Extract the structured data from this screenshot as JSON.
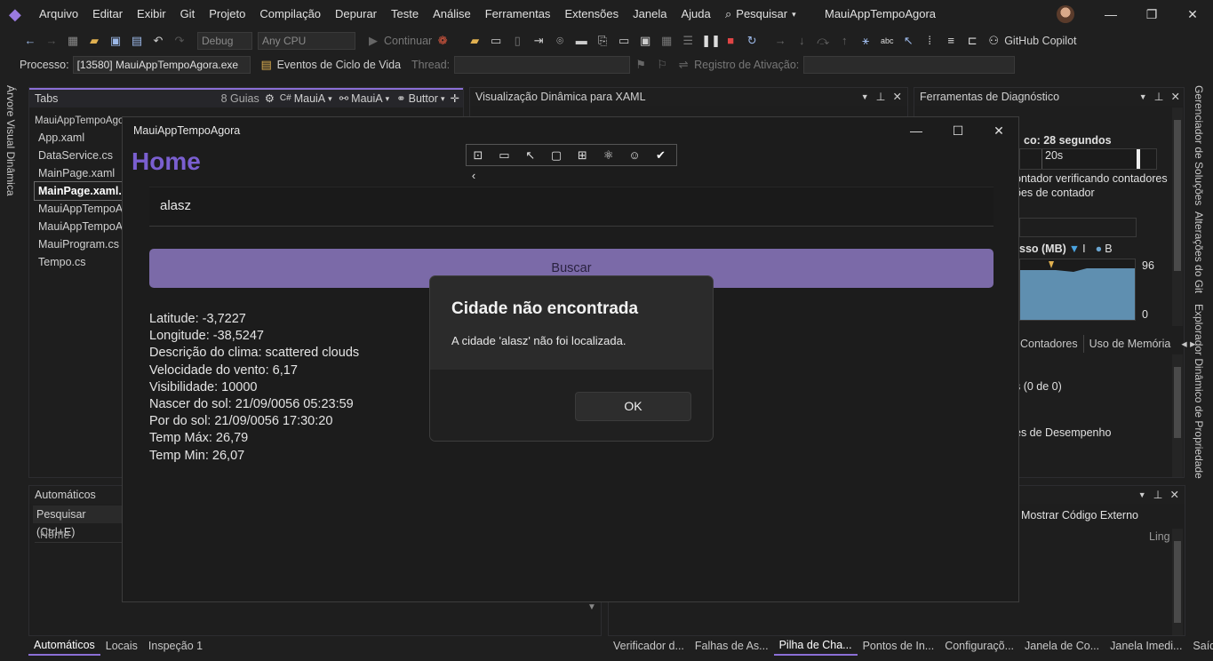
{
  "menubar": {
    "items": [
      "Arquivo",
      "Editar",
      "Exibir",
      "Git",
      "Projeto",
      "Compilação",
      "Depurar",
      "Teste",
      "Análise",
      "Ferramentas",
      "Extensões",
      "Janela",
      "Ajuda"
    ],
    "search_label": "Pesquisar",
    "solution_name": "MauiAppTempoAgora"
  },
  "toolbar1": {
    "config": "Debug",
    "platform": "Any CPU",
    "continue_label": "Continuar",
    "copilot_label": "GitHub Copilot"
  },
  "toolbar2": {
    "process_label": "Processo:",
    "process_value": "[13580] MauiAppTempoAgora.exe",
    "lifecycle_label": "Eventos de Ciclo de Vida",
    "thread_label": "Thread:",
    "stackframe_label": "Registro de Ativação:"
  },
  "left_vtab": "Árvore Visual Dinâmica",
  "right_vtabs": [
    "Gerenciador de Soluções",
    "Alterações do Git",
    "Explorador Dinâmico de Propriedade"
  ],
  "tabs_panel": {
    "title": "Tabs",
    "count": "8 Guias",
    "dd1": "MauiA",
    "dd2": "MauiA",
    "dd3": "Buttor",
    "files": [
      "MauiAppTempoAgora",
      "App.xaml",
      "DataService.cs",
      "MainPage.xaml",
      "MainPage.xaml.cs",
      "MauiAppTempoA",
      "MauiAppTempoA",
      "MauiProgram.cs",
      "Tempo.cs"
    ],
    "selected_index": 4
  },
  "xaml_panel": {
    "title": "Visualização Dinâmica para XAML"
  },
  "diag_panel": {
    "title": "Ferramentas de Diagnóstico",
    "session": "co: 28 segundos",
    "timeline_tick": "20s",
    "counter_msg1": "ontador verificando contadores",
    "counter_msg2": "ões de contador",
    "memory_label": "sso (MB)",
    "legend_a": "I",
    "legend_b": "B",
    "mem_max": "96",
    "mem_min": "0",
    "tabs": [
      "Contadores",
      "Uso de Memória"
    ],
    "events_count": "s (0 de 0)",
    "perf_label": "es de Desempenho"
  },
  "auto_panel": {
    "title": "Automáticos",
    "search": "Pesquisar (Ctrl+E)",
    "col_name": "Nome"
  },
  "stack_panel": {
    "external_code": "Mostrar Código Externo",
    "col_lang": "Ling"
  },
  "bottom_tabs_left": [
    "Automáticos",
    "Locais",
    "Inspeção 1"
  ],
  "bottom_tabs_right": [
    "Verificador d...",
    "Falhas de As...",
    "Pilha de Cha...",
    "Pontos de In...",
    "Configuraçõ...",
    "Janela de Co...",
    "Janela Imedi...",
    "Saída"
  ],
  "app": {
    "window_title": "MauiAppTempoAgora",
    "page_title": "Home",
    "city_value": "alasz",
    "search_button": "Buscar",
    "info_lines": [
      "Latitude: -3,7227",
      "Longitude: -38,5247",
      "Descrição do clima: scattered clouds",
      "Velocidade do vento: 6,17",
      "Visibilidade: 10000",
      "Nascer do sol: 21/09/0056 05:23:59",
      "Por do sol: 21/09/0056 17:30:20",
      "Temp Máx: 26,79",
      "Temp Min: 26,07"
    ]
  },
  "dialog": {
    "title": "Cidade não encontrada",
    "message": "A cidade 'alasz' não foi localizada.",
    "ok_label": "OK"
  },
  "colors": {
    "accent": "#7a5fd0",
    "button": "#7b6aa8",
    "stop_red": "#e04545"
  }
}
